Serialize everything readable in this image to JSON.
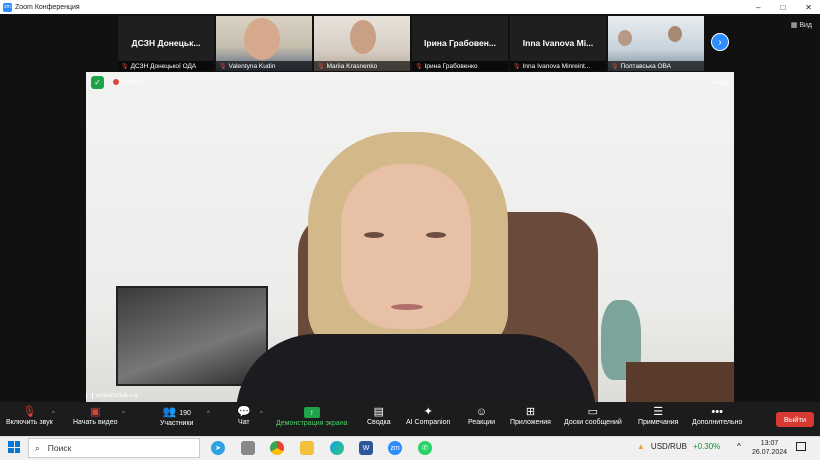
{
  "window": {
    "title": "Zoom Конференция",
    "controls": [
      "–",
      "□",
      "✕"
    ]
  },
  "view_label": "Вид",
  "gallery": [
    {
      "big_name": "ДСЗН Донецьк...",
      "caption": "ДСЗН Донецької ОДА",
      "video": false
    },
    {
      "big_name": "",
      "caption": "Valentyna Kudin",
      "video": true
    },
    {
      "big_name": "",
      "caption": "Mariia Krasnenko",
      "video": true
    },
    {
      "big_name": "Ірина Грабовен...",
      "caption": "Ірина Грабовенко",
      "video": false
    },
    {
      "big_name": "Inna Ivanova Mi...",
      "caption": "Inna Ivanova Minreint...",
      "video": false
    },
    {
      "big_name": "",
      "caption": "Полтавська ОВА",
      "video": true
    }
  ],
  "main_video": {
    "recording_label": "Запись",
    "fullscreen_label": "Вход",
    "speaker_name": "vereshchuk-i-a"
  },
  "toolbar": {
    "audio": "Включить звук",
    "video": "Начать видео",
    "participants": "Участники",
    "participants_count": "190",
    "chat": "Чат",
    "share": "Демонстрация экрана",
    "summary": "Сводка",
    "ai": "AI Companion",
    "reactions": "Реакции",
    "apps": "Приложения",
    "whiteboards": "Доски сообщений",
    "notes": "Примечания",
    "more": "Дополнительно",
    "leave": "Выйти"
  },
  "taskbar": {
    "search_placeholder": "Поиск",
    "apps": [
      "telegram-app",
      "files-app",
      "chrome-app",
      "explorer-app",
      "edge-app",
      "word-app",
      "zoom-app",
      "whatsapp-app"
    ],
    "word_letter": "W",
    "zoom_letters": "zm",
    "currency": "USD/RUB",
    "currency_change": "+0.30%",
    "time": "13:07",
    "date": "26.07.2024"
  },
  "colors": {
    "accent": "#2d8cff",
    "share_green": "#1fa24a",
    "leave_red": "#d63a31"
  }
}
